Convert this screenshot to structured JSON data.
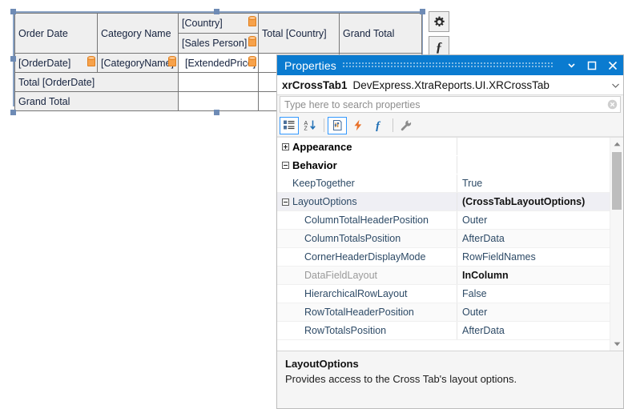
{
  "design": {
    "crosstab": {
      "header_row": {
        "order_date": "Order Date",
        "category_name": "Category Name",
        "country": "[Country]",
        "sales_person": "[Sales Person]",
        "total_country": "Total [Country]",
        "grand_total": "Grand Total"
      },
      "data_row": {
        "order_date": "[OrderDate]",
        "category_name": "[CategoryName]",
        "extended_price": "[ExtendedPrice]"
      },
      "total_row_label": "Total [OrderDate]",
      "grand_total_row_label": "Grand Total"
    },
    "smart_tags": {
      "gear_icon": "gear-icon",
      "expression_icon": "fx-icon"
    }
  },
  "properties_window": {
    "title": "Properties",
    "titlebar_buttons": {
      "dropdown": "chevron-down-icon",
      "maximize": "maximize-icon",
      "close": "close-icon"
    },
    "object": {
      "name": "xrCrossTab1",
      "type": "DevExpress.XtraReports.UI.XRCrossTab",
      "caret": "chevron-down-icon"
    },
    "search": {
      "placeholder": "Type here to search properties",
      "value": "",
      "clear_icon": "clear-circle-icon"
    },
    "toolbar": [
      {
        "name": "categorized-button",
        "icon": "categorized-icon",
        "active": true
      },
      {
        "name": "alphabetical-button",
        "icon": "sort-az-icon",
        "active": false
      },
      {
        "name": "properties-button",
        "icon": "properties-page-icon",
        "active": true
      },
      {
        "name": "events-button",
        "icon": "lightning-icon",
        "active": false
      },
      {
        "name": "expressions-button",
        "icon": "fx-icon",
        "active": false
      },
      {
        "name": "property-pages-button",
        "icon": "wrench-icon",
        "active": false
      }
    ],
    "grid": [
      {
        "kind": "category",
        "expander": "plus",
        "name": "Appearance",
        "value": "",
        "indent": 0,
        "dim": false,
        "bold_value": false
      },
      {
        "kind": "category",
        "expander": "minus",
        "name": "Behavior",
        "value": "",
        "indent": 0,
        "dim": false,
        "bold_value": false
      },
      {
        "kind": "prop",
        "expander": "none",
        "name": "KeepTogether",
        "value": "True",
        "indent": 0,
        "dim": false,
        "bold_value": false
      },
      {
        "kind": "prop",
        "expander": "minus",
        "name": "LayoutOptions",
        "value": "(CrossTabLayoutOptions)",
        "indent": 0,
        "dim": false,
        "bold_value": true
      },
      {
        "kind": "prop",
        "expander": "none",
        "name": "ColumnTotalHeaderPosition",
        "value": "Outer",
        "indent": 1,
        "dim": false,
        "bold_value": false
      },
      {
        "kind": "prop",
        "expander": "none",
        "name": "ColumnTotalsPosition",
        "value": "AfterData",
        "indent": 1,
        "dim": false,
        "bold_value": false
      },
      {
        "kind": "prop",
        "expander": "none",
        "name": "CornerHeaderDisplayMode",
        "value": "RowFieldNames",
        "indent": 1,
        "dim": false,
        "bold_value": false
      },
      {
        "kind": "prop",
        "expander": "none",
        "name": "DataFieldLayout",
        "value": "InColumn",
        "indent": 1,
        "dim": true,
        "bold_value": true
      },
      {
        "kind": "prop",
        "expander": "none",
        "name": "HierarchicalRowLayout",
        "value": "False",
        "indent": 1,
        "dim": false,
        "bold_value": false
      },
      {
        "kind": "prop",
        "expander": "none",
        "name": "RowTotalHeaderPosition",
        "value": "Outer",
        "indent": 1,
        "dim": false,
        "bold_value": false
      },
      {
        "kind": "prop",
        "expander": "none",
        "name": "RowTotalsPosition",
        "value": "AfterData",
        "indent": 1,
        "dim": false,
        "bold_value": false
      }
    ],
    "scrollbar": {
      "up_arrow": "caret-up-icon",
      "down_arrow": "caret-down-icon"
    },
    "description": {
      "title": "LayoutOptions",
      "text": "Provides access to the Cross Tab's layout options."
    }
  },
  "colors": {
    "titlebar": "#0a7bd0",
    "field_marker": "#f7a24b",
    "selection_handle": "#6e8bb5",
    "toolbar_active_border": "#3399ff"
  }
}
